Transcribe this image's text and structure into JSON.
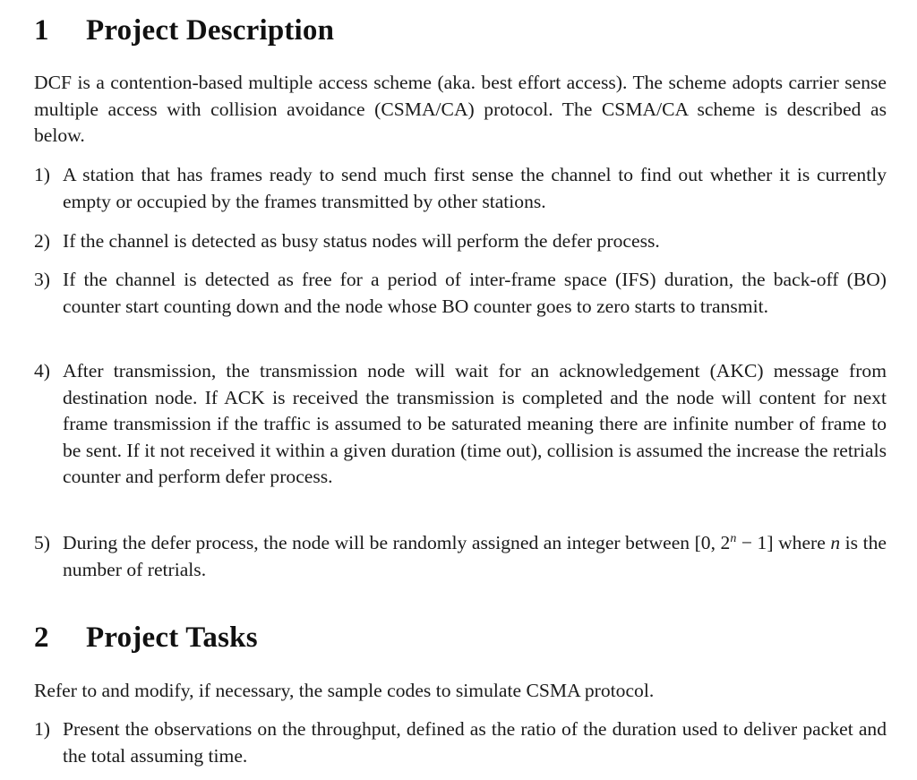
{
  "sections": [
    {
      "number": "1",
      "title": "Project Description",
      "intro": "DCF is a contention-based multiple access scheme (aka.  best effort access).  The scheme adopts carrier sense multiple access with collision avoidance (CSMA/CA) protocol.  The CSMA/CA scheme is described as below.",
      "items": [
        {
          "marker": "1)",
          "text": "A station that has frames ready to send much first sense the channel to find out whether it is currently empty or occupied by the frames transmitted by other stations."
        },
        {
          "marker": "2)",
          "text": "If the channel is detected as busy status nodes will perform the defer process."
        },
        {
          "marker": "3)",
          "text": "If the channel is detected as free for a period of inter-frame space (IFS) duration, the back-off (BO) counter start counting down and the node whose BO counter goes to zero starts to transmit."
        },
        {
          "marker": "4)",
          "text": "After transmission, the transmission node will wait for an acknowledgement (AKC) message from destination node.  If ACK is received the transmission is completed and the node will content for next frame transmission if the traffic is assumed to be saturated meaning there are infinite number of frame to be sent. If it not received it within a given duration (time out), collision is assumed the increase the retrials counter and perform defer process."
        },
        {
          "marker": "5)",
          "text_before": "During the defer process, the node will be randomly assigned an integer between [0, 2",
          "superscript": "n",
          "text_after": " − 1] where ",
          "math_var": "n",
          "text_end": " is the number of retrials."
        }
      ]
    },
    {
      "number": "2",
      "title": "Project Tasks",
      "intro": "Refer to and modify, if necessary, the sample codes to simulate CSMA protocol.",
      "items": [
        {
          "marker": "1)",
          "text": "Present the observations on the throughput, defined as the ratio of the duration used to deliver packet and the total assuming time."
        }
      ]
    }
  ]
}
